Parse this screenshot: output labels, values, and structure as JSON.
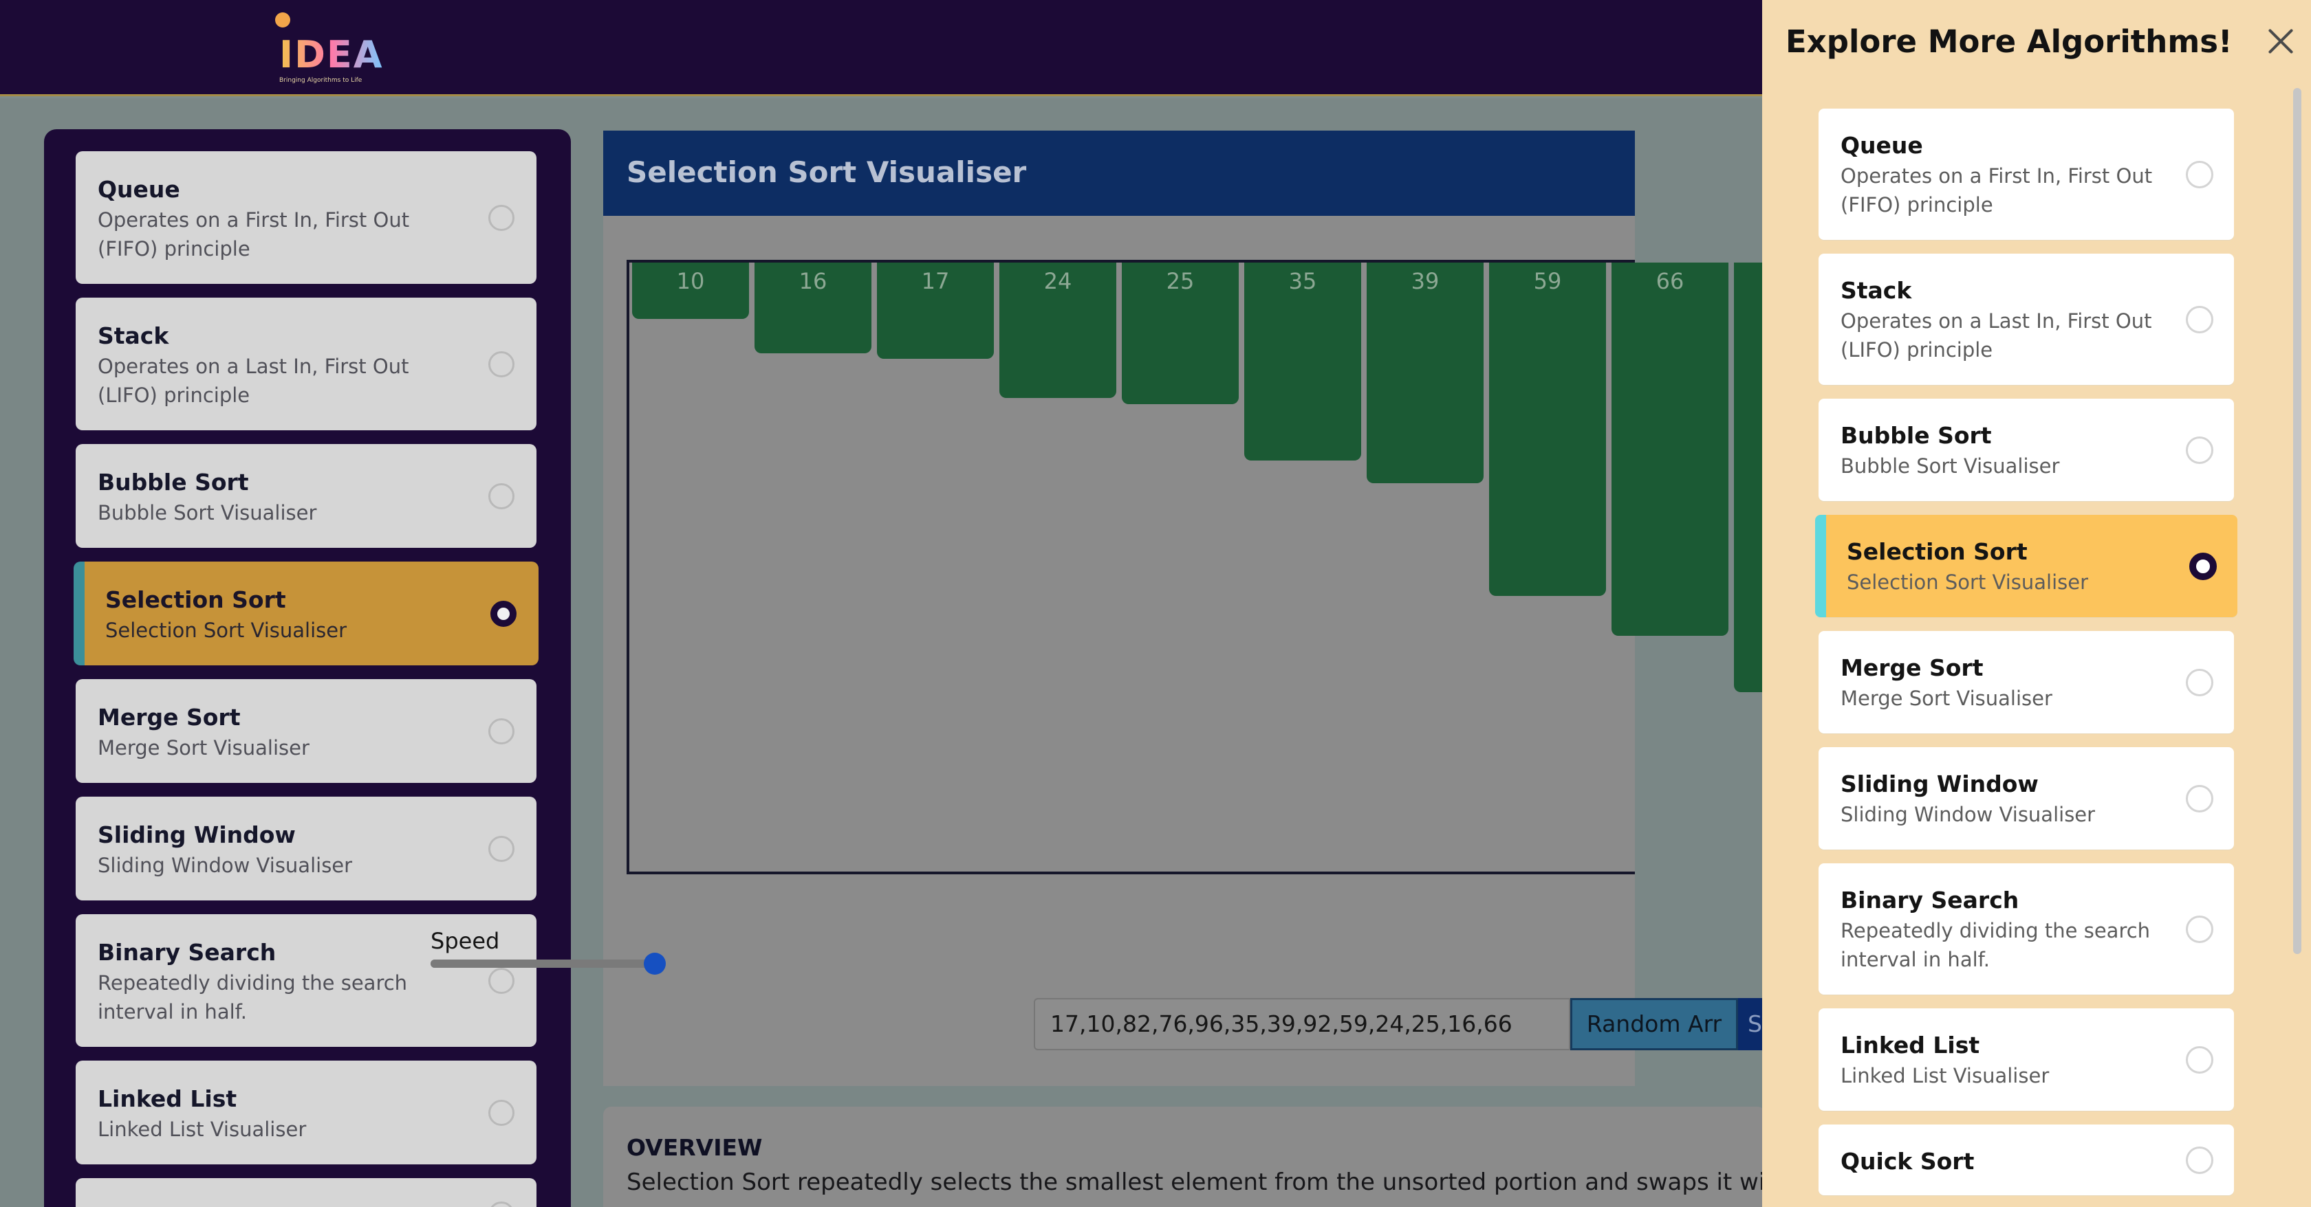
{
  "app": {
    "logo_text": "IDEA",
    "logo_tagline": "Bringing Algorithms to Life"
  },
  "algorithms": [
    {
      "title": "Queue",
      "description": "Operates on a First In, First Out (FIFO) principle",
      "selected": false
    },
    {
      "title": "Stack",
      "description": "Operates on a Last In, First Out (LIFO) principle",
      "selected": false
    },
    {
      "title": "Bubble Sort",
      "description": "Bubble Sort Visualiser",
      "selected": false
    },
    {
      "title": "Selection Sort",
      "description": "Selection Sort Visualiser",
      "selected": true
    },
    {
      "title": "Merge Sort",
      "description": "Merge Sort Visualiser",
      "selected": false
    },
    {
      "title": "Sliding Window",
      "description": "Sliding Window Visualiser",
      "selected": false
    },
    {
      "title": "Binary Search",
      "description": "Repeatedly dividing the search interval in half.",
      "selected": false
    },
    {
      "title": "Linked List",
      "description": "Linked List Visualiser",
      "selected": false
    },
    {
      "title": "Quick Sort",
      "description": "",
      "selected": false
    }
  ],
  "visualiser": {
    "title": "Selection Sort Visualiser",
    "bars": [
      {
        "label": "10",
        "value": 10
      },
      {
        "label": "16",
        "value": 16
      },
      {
        "label": "17",
        "value": 17
      },
      {
        "label": "24",
        "value": 24
      },
      {
        "label": "25",
        "value": 25
      },
      {
        "label": "35",
        "value": 35
      },
      {
        "label": "39",
        "value": 39
      },
      {
        "label": "59",
        "value": 59
      },
      {
        "label": "66",
        "value": 66
      },
      {
        "label": "",
        "value": 76
      }
    ],
    "speed_label": "Speed",
    "speed_value": 0.95,
    "array_input_value": "17,10,82,76,96,35,39,92,59,24,25,16,66",
    "random_button_label": "Random Arr",
    "sort_button_label": "S"
  },
  "overview": {
    "heading": "OVERVIEW",
    "text": "Selection Sort repeatedly selects the smallest element from the unsorted portion and swaps it with the f"
  },
  "drawer": {
    "title": "Explore More Algorithms!"
  },
  "colors": {
    "topbar": "#1c0a36",
    "accent_selected": "#fcc45c",
    "bar_green": "#1b5a34",
    "header_blue": "#0d2d63"
  }
}
